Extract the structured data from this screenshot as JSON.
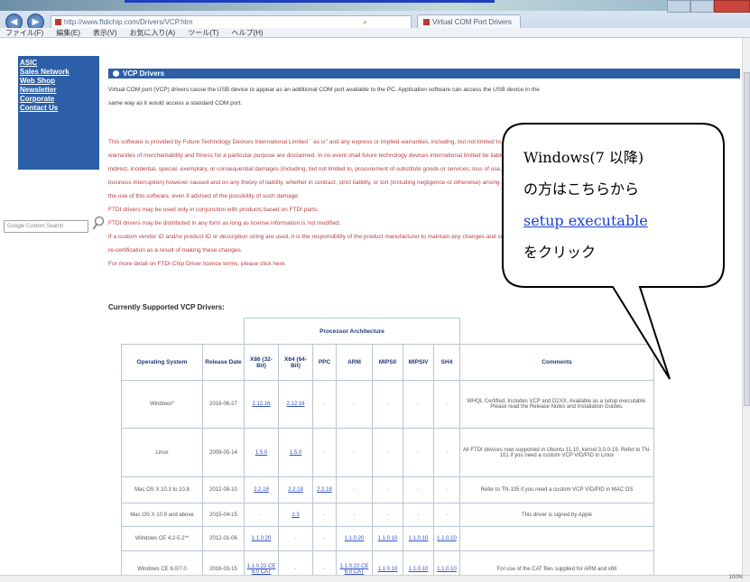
{
  "browser": {
    "address": "http://www.ftdichip.com/Drivers/VCP.htm",
    "search_glyph": "⌕",
    "tab_title": "Virtual COM Port Drivers",
    "back_icon": "back-arrow-icon",
    "forward_icon": "forward-arrow-icon",
    "menu": [
      "ファイル(F)",
      "編集(E)",
      "表示(V)",
      "お気に入り(A)",
      "ツール(T)",
      "ヘルプ(H)"
    ],
    "zoom": "100%"
  },
  "sidebar": {
    "items": [
      "ASIC",
      "Sales Network",
      "Web Shop",
      "Newsletter",
      "Corporate",
      "Contact Us"
    ],
    "search_placeholder": "Google Custom Search"
  },
  "main": {
    "section_title": "VCP Drivers",
    "intro": [
      "Virtual COM port (VCP) drivers cause the USB device to appear as an additional COM port available to the PC.  Application software can access the USB device in the",
      "same way as it would access a standard COM port."
    ],
    "disclaimer": [
      "This software is provided by Future Technology Devices International Limited ``as is'' and any express or implied warranties, including, but not limited to, the implied",
      "warranties of merchantability and fitness for a particular purpose are disclaimed. In no event shall future technology devices international limited be liable for any direct,",
      "indirect, incidental, special, exemplary, or consequential damages (including, but not limited to, procurement of substitute goods or services; loss of use, data, or profits; or",
      "business interruption) however caused and on any theory of liability, whether in contract, strict liability, or tort (including negligence or otherwise) arising in any way out of",
      "the use of this software, even if advised of the possibility of such damage.",
      "FTDI drivers may be used only in conjunction with products based on FTDI parts.",
      "FTDI drivers may be distributed in any form as long as license information is not modified.",
      "If a custom vendor ID and/or product ID or description string are used, it is the responsibility of the product manufacturer to maintain any changes and subsequent WHQL",
      "re-certification as a result of making these changes.",
      "For more detail on FTDI Chip Driver licence terms, please click here."
    ],
    "supported_heading": "Currently Supported VCP Drivers:"
  },
  "table": {
    "arch_group": "Processor Architecture",
    "headers": [
      "Operating System",
      "Release Date",
      "X86 (32-Bit)",
      "X64 (64-Bit)",
      "PPC",
      "ARM",
      "MIPSII",
      "MIPSIV",
      "SH4",
      "Comments"
    ],
    "rows": [
      {
        "os": "Windows*",
        "date": "2016-06-27",
        "cells": [
          "2.12.16",
          "2.12.16",
          "-",
          "-",
          "-",
          "-",
          "-"
        ],
        "comment": "WHQL Certified. Includes VCP and D2XX. Available as a setup executable. Please read the Release Notes and Installation Guides."
      },
      {
        "os": "Linux",
        "date": "2009-05-14",
        "cells": [
          "1.5.0",
          "1.5.0",
          "-",
          "-",
          "-",
          "-",
          "-"
        ],
        "comment": "All FTDI devices now supported in Ubuntu 11.10, kernel 3.0.0-19. Refer to TN-101 if you need a custom VCP VID/PID in Linux"
      },
      {
        "os": "Mac OS X 10.3 to 10.8",
        "date": "2012-08-10",
        "cells": [
          "2.2.18",
          "2.2.18",
          "2.2.18",
          "-",
          "-",
          "-",
          "-"
        ],
        "comment": "Refer to TN-105 if you need a custom VCP VID/PID in MAC OS"
      },
      {
        "os": "Mac OS X 10.9 and above",
        "date": "2015-04-15",
        "cells": [
          "-",
          "2.3",
          "-",
          "-",
          "-",
          "-",
          "-"
        ],
        "comment": "This driver is signed by Apple"
      },
      {
        "os": "Windows CE 4.2-5.2**",
        "date": "2012-01-06",
        "cells": [
          "1.1.0.20",
          "-",
          "-",
          "1.1.0.20",
          "1.1.0.10",
          "1.1.0.10",
          "1.1.0.10"
        ],
        "comment": ""
      },
      {
        "os": "Windows CE 6.0/7.0",
        "date": "2016-03-15",
        "cells": [
          "1.1.0.22 CE 6.0 CAT",
          "-",
          "-",
          "1.1.0.22 CE 6.0 CAT",
          "1.1.0.10",
          "1.1.0.10",
          "1.1.0.10"
        ],
        "comment": "For use of the CAT files supplied for ARM and x86"
      }
    ]
  },
  "callout": {
    "line1": "Windows(7 以降)",
    "line2": "の方はこちらから",
    "link": "setup executable",
    "line4": "をクリック"
  }
}
